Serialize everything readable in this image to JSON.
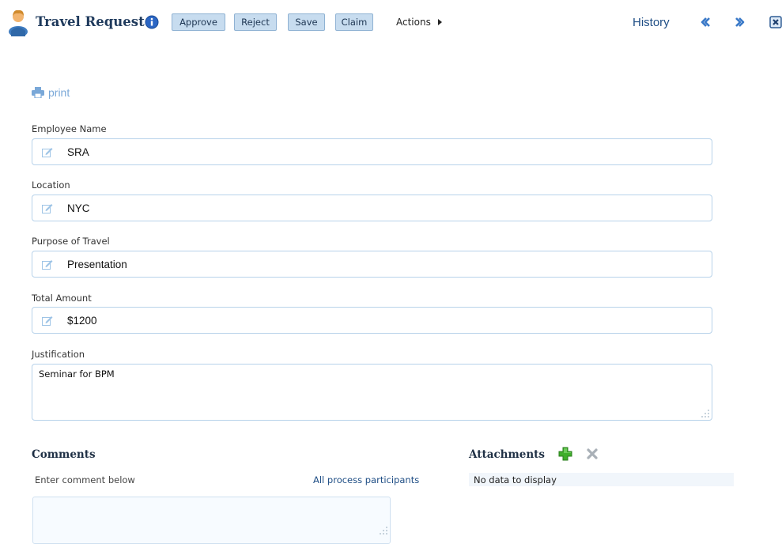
{
  "header": {
    "title": "Travel Request",
    "buttons": {
      "approve": "Approve",
      "reject": "Reject",
      "save": "Save",
      "claim": "Claim"
    },
    "actions_label": "Actions",
    "history_label": "History",
    "icons": [
      "user-avatar-icon",
      "info-icon",
      "chevron-left-icon",
      "chevron-right-icon",
      "close-icon"
    ]
  },
  "print_label": "print",
  "form": {
    "employee_name": {
      "label": "Employee Name",
      "value": "SRA"
    },
    "location": {
      "label": "Location",
      "value": "NYC"
    },
    "purpose": {
      "label": "Purpose of Travel",
      "value": "Presentation"
    },
    "total_amount": {
      "label": "Total Amount",
      "value": "$1200"
    },
    "justification": {
      "label": "Justification",
      "value": "Seminar for BPM"
    }
  },
  "comments": {
    "heading": "Comments",
    "hint": "Enter comment below",
    "participants_link": "All process participants"
  },
  "attachments": {
    "heading": "Attachments",
    "empty_text": "No data to display"
  },
  "colors": {
    "button_bg": "#c7dcef",
    "button_border": "#8fb2d3",
    "field_border": "#b7d2ea",
    "link": "#1f4e85",
    "print_link": "#7aa8d8",
    "heading": "#1f3a5c"
  }
}
